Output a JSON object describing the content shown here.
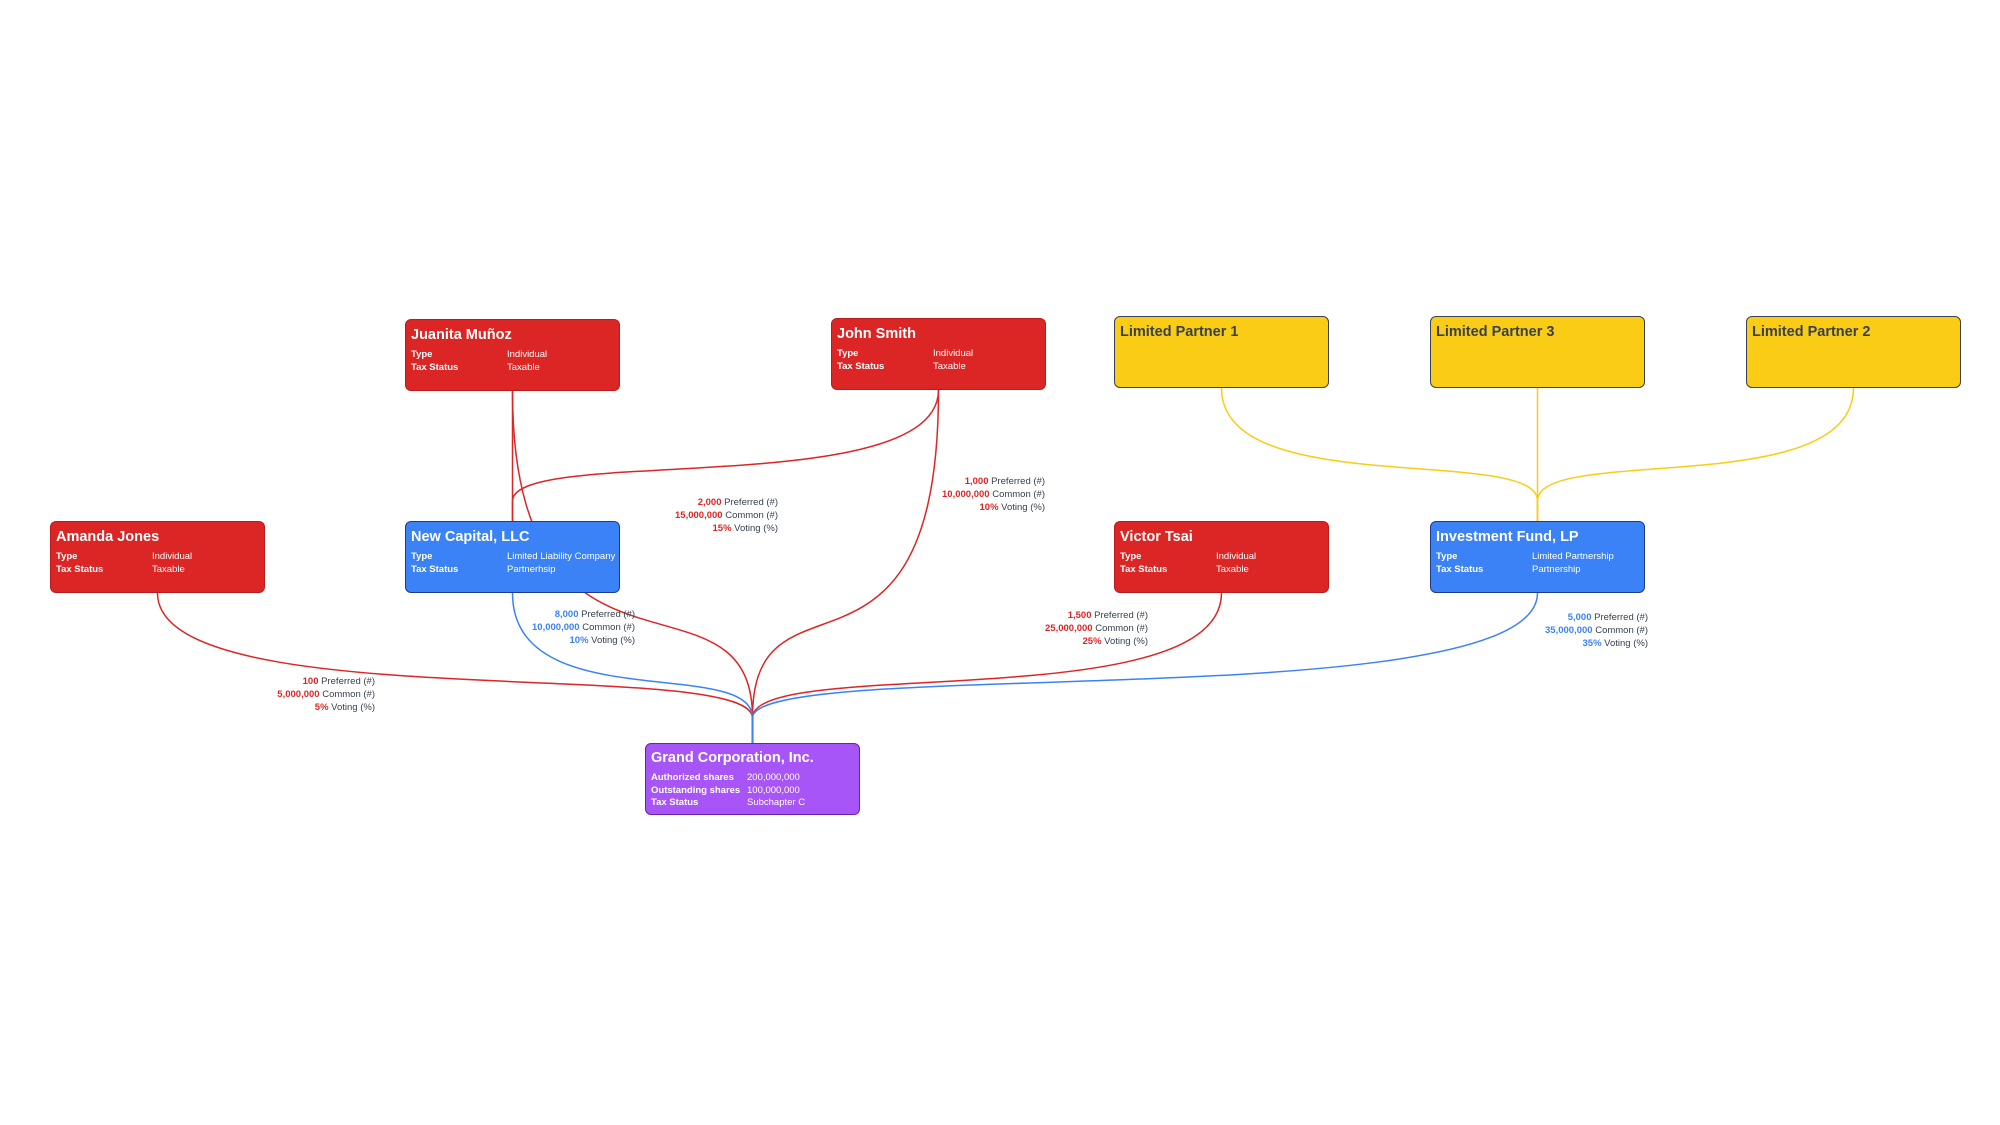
{
  "colors": {
    "individual": "#dc2626",
    "entity": "#3b82f6",
    "company": "#a855f7",
    "limited_partner": "#facc15",
    "edge_red": "#dc2626",
    "edge_blue": "#3b82f6",
    "edge_yellow": "#facc15"
  },
  "company": {
    "id": "grand",
    "title": "Grand Corporation, Inc.",
    "rows": [
      {
        "key": "Authorized shares",
        "value": "200,000,000"
      },
      {
        "key": "Outstanding shares",
        "value": "100,000,000"
      },
      {
        "key": "Tax Status",
        "value": "Subchapter C"
      }
    ]
  },
  "shareholders": [
    {
      "id": "juanita",
      "title": "Juanita Muñoz",
      "kind": "individual",
      "rows": [
        {
          "key": "Type",
          "value": "Individual"
        },
        {
          "key": "Tax Status",
          "value": "Taxable"
        }
      ]
    },
    {
      "id": "john",
      "title": "John Smith",
      "kind": "individual",
      "rows": [
        {
          "key": "Type",
          "value": "Individual"
        },
        {
          "key": "Tax Status",
          "value": "Taxable"
        }
      ]
    },
    {
      "id": "amanda",
      "title": "Amanda Jones",
      "kind": "individual",
      "rows": [
        {
          "key": "Type",
          "value": "Individual"
        },
        {
          "key": "Tax Status",
          "value": "Taxable"
        }
      ]
    },
    {
      "id": "newcap",
      "title": "New Capital, LLC",
      "kind": "entity",
      "rows": [
        {
          "key": "Type",
          "value": "Limited Liability Company"
        },
        {
          "key": "Tax Status",
          "value": "Partnerhsip"
        }
      ]
    },
    {
      "id": "victor",
      "title": "Victor Tsai",
      "kind": "individual",
      "rows": [
        {
          "key": "Type",
          "value": "Individual"
        },
        {
          "key": "Tax Status",
          "value": "Taxable"
        }
      ]
    },
    {
      "id": "fund",
      "title": "Investment Fund, LP",
      "kind": "entity",
      "rows": [
        {
          "key": "Type",
          "value": "Limited Partnership"
        },
        {
          "key": "Tax Status",
          "value": "Partnership"
        }
      ]
    }
  ],
  "limited_partners": [
    {
      "id": "lp1",
      "title": "Limited Partner 1"
    },
    {
      "id": "lp3",
      "title": "Limited Partner 3"
    },
    {
      "id": "lp2",
      "title": "Limited Partner 2"
    }
  ],
  "holdings": [
    {
      "from": "juanita",
      "to": "grand",
      "color": "red",
      "preferred": "2,000",
      "common": "15,000,000",
      "voting": "15%"
    },
    {
      "from": "john",
      "to": "grand",
      "color": "red",
      "preferred": "1,000",
      "common": "10,000,000",
      "voting": "10%"
    },
    {
      "from": "amanda",
      "to": "grand",
      "color": "red",
      "preferred": "100",
      "common": "5,000,000",
      "voting": "5%"
    },
    {
      "from": "newcap",
      "to": "grand",
      "color": "blue",
      "preferred": "8,000",
      "common": "10,000,000",
      "voting": "10%"
    },
    {
      "from": "victor",
      "to": "grand",
      "color": "red",
      "preferred": "1,500",
      "common": "25,000,000",
      "voting": "25%"
    },
    {
      "from": "fund",
      "to": "grand",
      "color": "blue",
      "preferred": "5,000",
      "common": "35,000,000",
      "voting": "35%"
    }
  ],
  "memberships": [
    {
      "from": "juanita",
      "to": "newcap",
      "color": "red"
    },
    {
      "from": "john",
      "to": "newcap",
      "color": "red"
    },
    {
      "from": "lp1",
      "to": "fund",
      "color": "yellow"
    },
    {
      "from": "lp3",
      "to": "fund",
      "color": "yellow"
    },
    {
      "from": "lp2",
      "to": "fund",
      "color": "yellow"
    }
  ],
  "label_text": {
    "preferred": "Preferred (#)",
    "common": "Common (#)",
    "voting": "Voting (%)"
  }
}
